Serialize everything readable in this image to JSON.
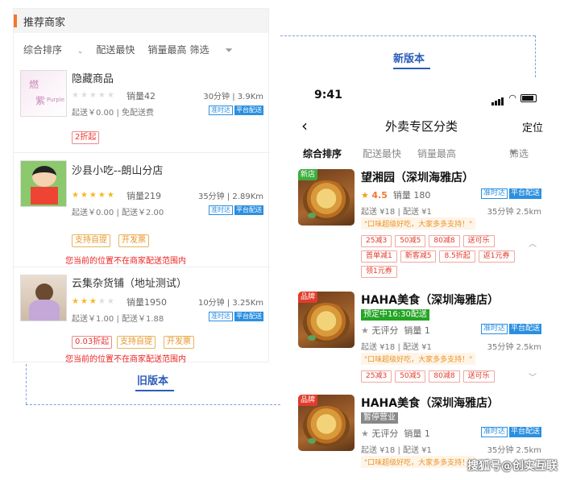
{
  "old": {
    "section_title": "推荐商家",
    "sort": {
      "comprehensive": "综合排序",
      "fastest": "配送最快",
      "best_sales": "销量最高",
      "filter": "筛选"
    },
    "shops": [
      {
        "name": "隐藏商品",
        "stars": "★★★★★",
        "sales": "销量42",
        "time": "30分钟",
        "distance": "3.9Km",
        "fee": "起送￥0.00 | 免配送费",
        "badges": {
          "on_time": "准时达",
          "platform": "平台配送"
        },
        "tags": [
          "2折起"
        ],
        "thumb_text_1": "燃",
        "thumb_text_2": "紫",
        "thumb_text_3": "Purple"
      },
      {
        "name": "沙县小吃--朗山分店",
        "stars": "★★★★★",
        "sales": "销量219",
        "time": "35分钟",
        "distance": "2.89Km",
        "fee": "起送￥0.00 | 配送￥2.00",
        "badges": {
          "on_time": "准时达",
          "platform": "平台配送"
        },
        "tags": [
          "支持自提",
          "开发票"
        ],
        "warning": "您当前的位置不在商家配送范围内"
      },
      {
        "name": "云集杂货铺（地址测试）",
        "stars": "★★★★★",
        "sales": "销量1950",
        "time": "10分钟",
        "distance": "3.25Km",
        "fee": "起送￥1.00 | 配送￥1.88",
        "badges": {
          "on_time": "准时达",
          "platform": "平台配送"
        },
        "tags": [
          "0.03折起",
          "支持自提",
          "开发票"
        ],
        "warning": "您当前的位置不在商家配送范围内"
      }
    ],
    "label": "旧版本"
  },
  "new": {
    "label": "新版本",
    "status_time": "9:41",
    "nav": {
      "back": "‹",
      "title": "外卖专区分类",
      "location": "定位"
    },
    "sort": {
      "comprehensive": "综合排序",
      "fastest": "配送最快",
      "best_sales": "销量最高",
      "filter": "筛选"
    },
    "shops": [
      {
        "tag": "新店",
        "name": "望湘园（深圳海雅店）",
        "rating": "4.5",
        "sales": "销量 180",
        "badges": {
          "on_time": "准时达",
          "platform": "平台配送"
        },
        "fee": "起送 ¥18  |  配送 ¥1",
        "time": "35分钟  2.5km",
        "quote": "\"口味超级好吃，大家多多支持！\"",
        "promos": [
          "25减3",
          "50减5",
          "80减8",
          "送可乐",
          "首单减1",
          "新客减5",
          "8.5折起",
          "返1元券",
          "领1元券"
        ]
      },
      {
        "tag": "品牌",
        "name": "HAHA美食（深圳海雅店）",
        "status": "预定中16:30配送",
        "rating": "无评分",
        "sales": "销量 1",
        "badges": {
          "on_time": "准时达",
          "platform": "平台配送"
        },
        "fee": "起送 ¥18  |  配送 ¥1",
        "time": "35分钟  2.5km",
        "quote": "\"口味超级好吃，大家多多支持！\"",
        "promos": [
          "25减3",
          "50减5",
          "80减8",
          "送可乐"
        ]
      },
      {
        "tag": "品牌",
        "name": "HAHA美食（深圳海雅店）",
        "status": "暂停营业",
        "rating": "无评分",
        "sales": "销量 1",
        "badges": {
          "on_time": "准时达",
          "platform": "平台配送"
        },
        "fee": "起送 ¥18  |  配送 ¥1",
        "time": "35分钟  2.5km",
        "quote": "\"口味超级好吃，大家多多支持！\""
      }
    ]
  },
  "watermark": "搜狐号@创实互联",
  "colors": {
    "accent_orange": "#f0782d",
    "label_blue": "#2b5db8",
    "platform_blue": "#2b8fe0",
    "promo_red": "#e23b2b"
  }
}
